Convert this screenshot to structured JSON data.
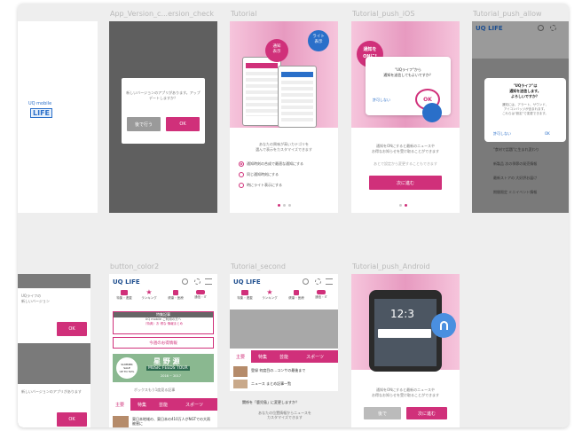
{
  "artboards": {
    "version_check": {
      "title": "App_Version_c...ersion_check",
      "dialog_msg": "新しいバージョンのアプリがあります。アップデートしますか？",
      "cancel_label": "後で行う",
      "ok_label": "OK"
    },
    "tutorial": {
      "title": "Tutorial",
      "badge1": "通知\n表示",
      "badge2": "ライト\n表示",
      "desc": "あなたの興味が高いカテゴリを\n選んで表示をカスタマイズできます",
      "options": [
        "通知時刻の合成で最適な通知にする",
        "同じ通知時刻にする",
        "時にライト表示にする"
      ]
    },
    "push_ios": {
      "title": "Tutorial_push_iOS",
      "badge": "通知を\nONに!",
      "dialog_msg": "\"UQライフ\"から\n通知を送信してもよいですか？",
      "cancel_label": "許可しない",
      "ok_label": "OK",
      "desc": "通知をONにすると最新のニュースや\nお得なお知らせを受け取ることができます",
      "sub": "あとで設定から変更することもできます",
      "next_label": "次に進む"
    },
    "push_allow": {
      "title": "Tutorial_push_allow",
      "logo": "UQ LIFE",
      "dialog_msg": "\"UQライフ\"は\n通知を送信します。\nよろしいですか？",
      "dialog_sub": "通知には、アラート、サウンド、\nアイコンバッジが含まれます。\nこれらは\"設定\"で変更できます。",
      "cancel_label": "許可しない",
      "ok_label": "OK",
      "list_items": [
        "\"食材で話題\"に生まれ変わり",
        "新製品 次の季節の発売情報",
        "最新ストアの 大好評お届け",
        "期間限定 ミニイベント情報"
      ]
    },
    "left_partial_top": {
      "logo_line1": "UQ mobile",
      "logo_line2": "LIFE"
    },
    "left_partial_bottom": {
      "ok_label": "OK",
      "ok_label2": "OK",
      "small_text1": "UQライフの\n新しいバージョン",
      "small_text2": "新しいバージョンのアプリがあります"
    },
    "button_color2": {
      "title": "button_color2",
      "logo": "UQ LIFE",
      "nav": [
        "特集・連載",
        "ランキング",
        "健康・医療",
        "通信・IT"
      ],
      "banner_head": "特集記事",
      "banner_sub1": "UQ mobile ご利用の方へ",
      "banner_sub2": "（特典）お 得な 情報まとめ",
      "cta": "今週のお得情報",
      "ad_badge": "SUMMER\nSALE\nUP TO 50%",
      "ad_title": "星 野 源",
      "ad_sub": "MUSIC FEEDS TOUR",
      "ad_year": "2016 ~ 2017",
      "ad_caption": "ボックスもう1度見る記事",
      "tabs": [
        "主要",
        "特集",
        "芸能",
        "スポーツ"
      ],
      "news": "東日本地域の、東日本の410万人がNGTでの大雨被害に"
    },
    "tutorial_second": {
      "title": "Tutorial_second",
      "logo": "UQ LIFE",
      "nav": [
        "特集・連載",
        "ランキング",
        "健康・医療",
        "通信・IT"
      ],
      "tabs": [
        "主要",
        "特集",
        "芸能",
        "スポーツ"
      ],
      "news1": "登録 何度目の…コンサの最後まで",
      "news2": "ニュース まとめ記事一覧",
      "question": "関係を「鹿児島」に変更しますか？",
      "sub": "あなたの位置情報からニュースを\nカスタマイズできます"
    },
    "push_android": {
      "title": "Tutorial_push_Android",
      "clock": "12:3",
      "desc": "通知をONにすると最新のニュースや\nお得なお知らせを受け取ることができます",
      "btn1": "後で",
      "btn2": "次に進む"
    }
  },
  "colors": {
    "accent": "#d0307a",
    "canvas": "#eeeeee",
    "dark_artboard": "#5f5f5f"
  },
  "icons": {
    "ok_touch": "pointing-hand-icon",
    "bell": "bell-icon",
    "search": "search-icon",
    "settings": "gear-icon",
    "menu": "hamburger-icon"
  }
}
